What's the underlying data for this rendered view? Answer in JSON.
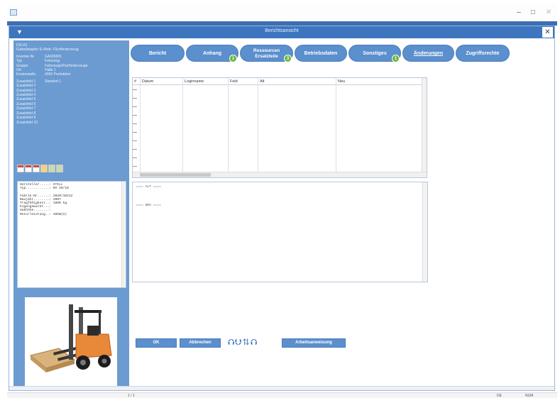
{
  "window": {
    "min_label": "–",
    "max_label": "□",
    "close_label": "✕"
  },
  "dialog": {
    "title": "Berichtsansicht",
    "close_label": "✕"
  },
  "info_panel": {
    "line1": "DS-01",
    "line2": "Gabelstapler E-Mob. Flurförderzeug",
    "fields": [
      {
        "k": "Inventar-Nr.",
        "v": "GA000001"
      },
      {
        "k": "Typ",
        "v": "Fahrzeug"
      },
      {
        "k": "Gruppe",
        "v": "Fahrzeuge/Flurförderzeuge"
      },
      {
        "k": "Ort",
        "v": "Halle 1"
      },
      {
        "k": "Kostenstelle",
        "v": "4000 Produktion"
      }
    ],
    "custom_fields": [
      {
        "k": "Zusatzfeld 1",
        "v": "Standort 1"
      },
      {
        "k": "Zusatzfeld 2",
        "v": ""
      },
      {
        "k": "Zusatzfeld 3",
        "v": ""
      },
      {
        "k": "Zusatzfeld 4",
        "v": ""
      },
      {
        "k": "Zusatzfeld 5",
        "v": ""
      },
      {
        "k": "Zusatzfeld 6",
        "v": ""
      },
      {
        "k": "Zusatzfeld 7",
        "v": ""
      },
      {
        "k": "Zusatzfeld 8",
        "v": ""
      },
      {
        "k": "Zusatzfeld 9",
        "v": ""
      },
      {
        "k": "Zusatzfeld 10",
        "v": ""
      }
    ]
  },
  "details_text": "Hersteller.....: STILL\nTyp............: RX 20/18\n\nFabrik-Nr......: 2020/10212\nBaujahr........: 2007\nTragfähigkeit..: 1800 kg\nEigengewicht...:\nHubhöhe........:\nMotorleistung..: 40kW(S)",
  "tabs": [
    {
      "label": "Bericht"
    },
    {
      "label": "Anhang",
      "badge": "1"
    },
    {
      "label": "Ressourcen\nErsatzteile",
      "badge": "3"
    },
    {
      "label": "Betriebsdaten"
    },
    {
      "label": "Sonstiges",
      "badge": "1"
    },
    {
      "label": "Änderungen"
    },
    {
      "label": "Zugriffsrechte"
    }
  ],
  "grid": {
    "columns": [
      "#",
      "Datum",
      "Loginname",
      "Feld",
      "Alt",
      "Neu"
    ]
  },
  "changelog": {
    "old_marker": "==== ALT ====",
    "new_marker": "==== NEU ===="
  },
  "buttons": {
    "ok": "OK",
    "cancel": "Abbrechen",
    "io_icons": "⮉⮋⇅⮉",
    "work_instruction": "Arbeitsanweisung"
  },
  "status": {
    "left": "1 / 1",
    "right1": "DE",
    "right2": "NUM"
  }
}
